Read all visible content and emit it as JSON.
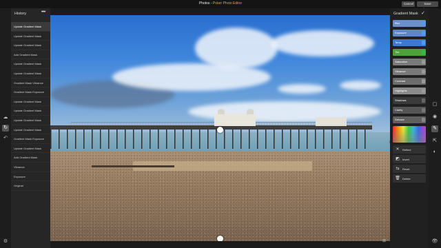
{
  "window": {
    "title_prefix": "Photos - ",
    "app_name": "Polarr Photo Editor",
    "cancel_label": "Cancel",
    "save_label": "Save Changes"
  },
  "history": {
    "title": "History",
    "more": "•••",
    "items": [
      {
        "label": "Update Gradient Mask",
        "selected": true
      },
      {
        "label": "Update Gradient Mask"
      },
      {
        "label": "Update Gradient Mask"
      },
      {
        "label": "Add Gradient Mask"
      },
      {
        "label": "Update Gradient Mask"
      },
      {
        "label": "Update Gradient Mask"
      },
      {
        "label": "Gradient Mask Vibrance"
      },
      {
        "label": "Gradient Mask Exposure"
      },
      {
        "label": "Update Gradient Mask"
      },
      {
        "label": "Update Gradient Mask"
      },
      {
        "label": "Update Gradient Mask"
      },
      {
        "label": "Update Gradient Mask"
      },
      {
        "label": "Gradient Mask Exposure"
      },
      {
        "label": "Update Gradient Mask"
      },
      {
        "label": "Add Gradient Mask"
      },
      {
        "label": "Vibrance"
      },
      {
        "label": "Exposure"
      },
      {
        "label": "Original"
      }
    ]
  },
  "panel": {
    "title": "Gradient Mask",
    "sliders": [
      {
        "label": "Blur",
        "color": "#6a8fc9",
        "knob": "#4f9de8"
      },
      {
        "label": "Exposure",
        "color": "#5f86c5",
        "knob": "#4f9de8"
      },
      {
        "label": "Temp",
        "color": "#3f78cf",
        "knob": "#4f9de8"
      },
      {
        "label": "Tint",
        "color": "#4ea23a",
        "knob": "#2fc04a"
      },
      {
        "label": "Saturation",
        "color": "#7a7a7a",
        "knob": "#9a9a9a"
      },
      {
        "label": "Vibrance",
        "color": "#7a7a7a",
        "knob": "#9a9a9a"
      },
      {
        "label": "Contrast",
        "color": "#6c6c6c",
        "knob": "#9a9a9a"
      },
      {
        "label": "Highlights",
        "color": "#8b8b8b",
        "knob": "#9a9a9a"
      },
      {
        "label": "Shadows",
        "color": "#3a3a3a",
        "knob": "#666666"
      },
      {
        "label": "Clarity",
        "color": "#555555",
        "knob": "#777777"
      },
      {
        "label": "Dehaze",
        "color": "#606060",
        "knob": "#888888"
      }
    ],
    "color_label": "Color",
    "actions": [
      {
        "icon": "✕",
        "label": "Reflect"
      },
      {
        "icon": "◩",
        "label": "Invert"
      },
      {
        "icon": "⇆",
        "label": "Reset"
      },
      {
        "icon": "🗑",
        "label": "Delete"
      }
    ]
  },
  "colors": {
    "accent": "#f29a3c",
    "background": "#1b1b1b"
  }
}
